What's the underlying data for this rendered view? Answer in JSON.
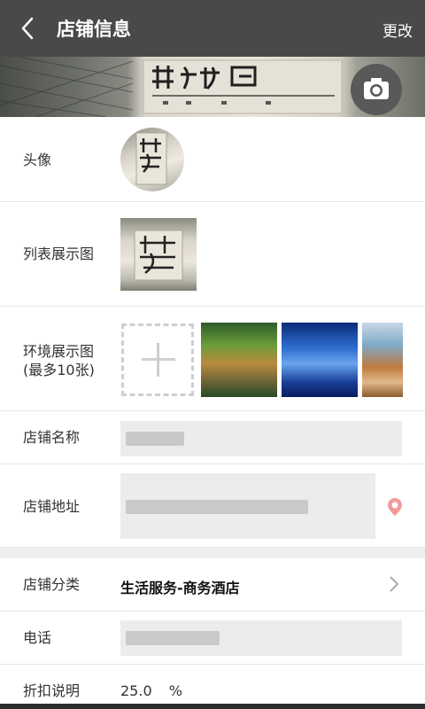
{
  "header": {
    "title": "店铺信息",
    "edit_label": "更改",
    "bg_color": "#4a4848"
  },
  "rows": {
    "avatar_label": "头像",
    "list_image_label": "列表展示图",
    "env_label_line1": "环境展示图",
    "env_label_line2": "(最多10张)",
    "shop_name_label": "店铺名称",
    "shop_address_label": "店铺地址",
    "shop_category_label": "店铺分类",
    "shop_category_value": "生活服务-商务酒店",
    "phone_label": "电话",
    "discount_label": "折扣说明",
    "discount_value": "25.0",
    "discount_unit": "%"
  },
  "icons": {
    "back": "chevron-left-icon",
    "camera": "camera-icon",
    "location": "location-pin-icon",
    "add": "plus-icon",
    "chevron": "chevron-right-icon"
  },
  "colors": {
    "pin": "#f29a9a",
    "field_bg": "#ececec"
  }
}
